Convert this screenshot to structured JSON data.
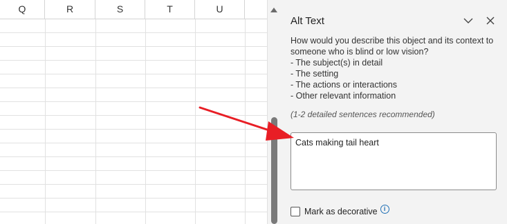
{
  "sheet": {
    "columns": [
      "Q",
      "R",
      "S",
      "T",
      "U"
    ]
  },
  "pane": {
    "title": "Alt Text",
    "description_lines": [
      "How would you describe this object and its context to",
      "someone who is blind or low vision?",
      "- The subject(s) in detail",
      "- The setting",
      "- The actions or interactions",
      "- Other relevant information"
    ],
    "hint": "(1-2 detailed sentences recommended)",
    "alt_text_value": "Cats making tail heart",
    "decorative_label": "Mark as decorative",
    "decorative_checked": false,
    "collapse_icon": "chevron-down-icon",
    "close_icon": "close-icon",
    "info_icon": "info-icon"
  },
  "colors": {
    "arrow": "#e81e25",
    "pane_bg": "#f3f3f3",
    "scroll_thumb": "#7a7a7a"
  }
}
